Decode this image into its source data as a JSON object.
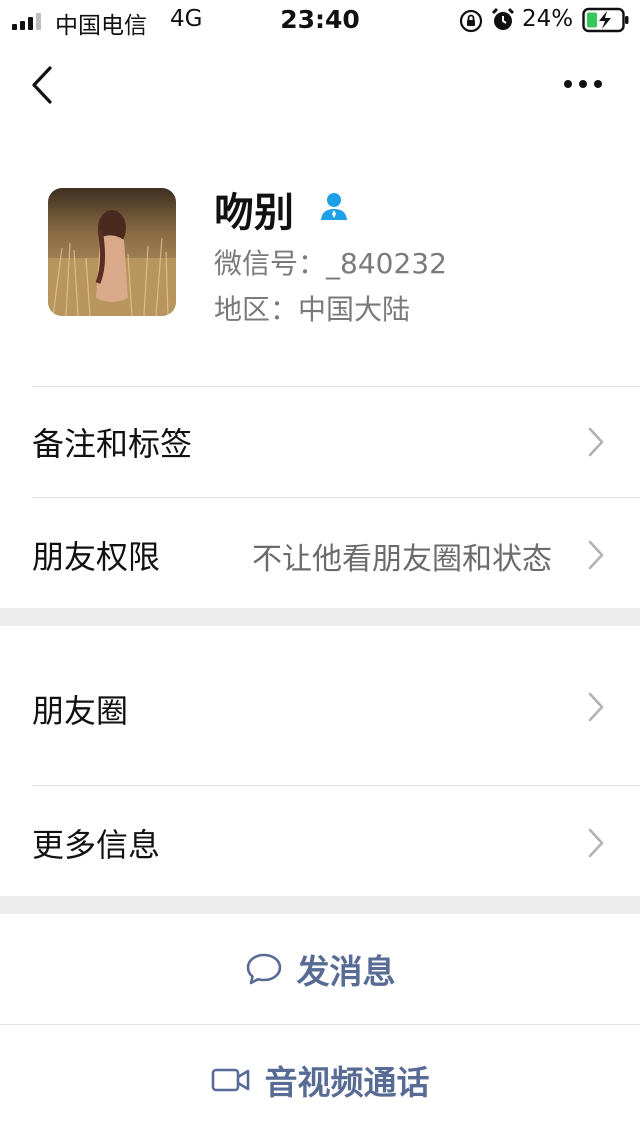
{
  "status_bar": {
    "carrier": "中国电信",
    "network": "4G",
    "time": "23:40",
    "battery_percent": "24%",
    "icons": [
      "signal-icon",
      "orientation-lock-icon",
      "alarm-icon",
      "battery-charging-icon"
    ]
  },
  "nav": {
    "back_icon": "chevron-left-icon",
    "more_icon": "more-horizontal-icon"
  },
  "profile": {
    "name": "吻别",
    "wechat_id": "微信号：_840232",
    "region": "地区：中国大陆",
    "badge_icon": "person-icon",
    "badge_color": "#1e9fe6"
  },
  "rows": {
    "remark_tags": {
      "label": "备注和标签"
    },
    "friend_permissions": {
      "label": "朋友权限",
      "value": "不让他看朋友圈和状态"
    },
    "moments": {
      "label": "朋友圈"
    },
    "more_info": {
      "label": "更多信息"
    }
  },
  "actions": {
    "send_message": {
      "label": "发消息",
      "icon": "chat-bubble-icon"
    },
    "av_call": {
      "label": "音视频通话",
      "icon": "video-camera-icon"
    },
    "link_color": "#576b95"
  }
}
